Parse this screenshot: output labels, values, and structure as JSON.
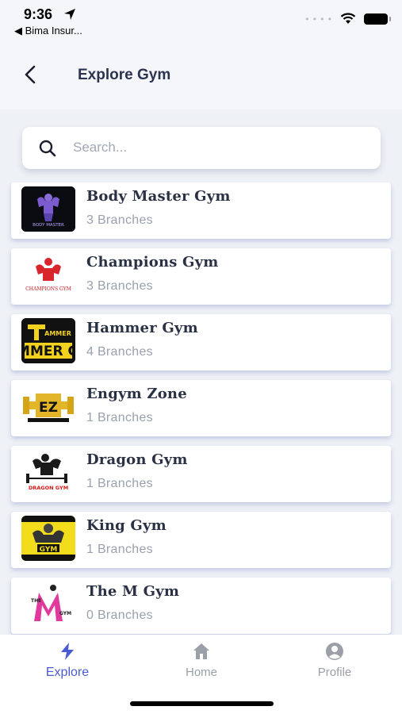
{
  "status_bar": {
    "time": "9:36",
    "back_app": "◀ Bima Insur...",
    "signal": "• • • •"
  },
  "header": {
    "title": "Explore Gym"
  },
  "search": {
    "placeholder": "Search...",
    "value": ""
  },
  "gyms": [
    {
      "name": "Body Master Gym",
      "branches": "3 Branches",
      "logo_text": "BODY MASTER"
    },
    {
      "name": "Champions Gym",
      "branches": "3 Branches",
      "logo_text": "CHAMPIONS GYM"
    },
    {
      "name": "Hammer Gym",
      "branches": "4 Branches",
      "logo_text": "HAMMER GYM"
    },
    {
      "name": "Engym Zone",
      "branches": "1 Branches",
      "logo_text": "EZ"
    },
    {
      "name": "Dragon Gym",
      "branches": "1 Branches",
      "logo_text": "DRAGON GYM"
    },
    {
      "name": "King Gym",
      "branches": "1 Branches",
      "logo_text": "GYM"
    },
    {
      "name": "The M Gym",
      "branches": "0 Branches",
      "logo_text": "THE M GYM"
    }
  ],
  "bottom_nav": {
    "explore": "Explore",
    "home": "Home",
    "profile": "Profile"
  },
  "colors": {
    "accent": "#4a5bd6",
    "inactive": "#9b9fa8",
    "background": "#eef1f6"
  }
}
